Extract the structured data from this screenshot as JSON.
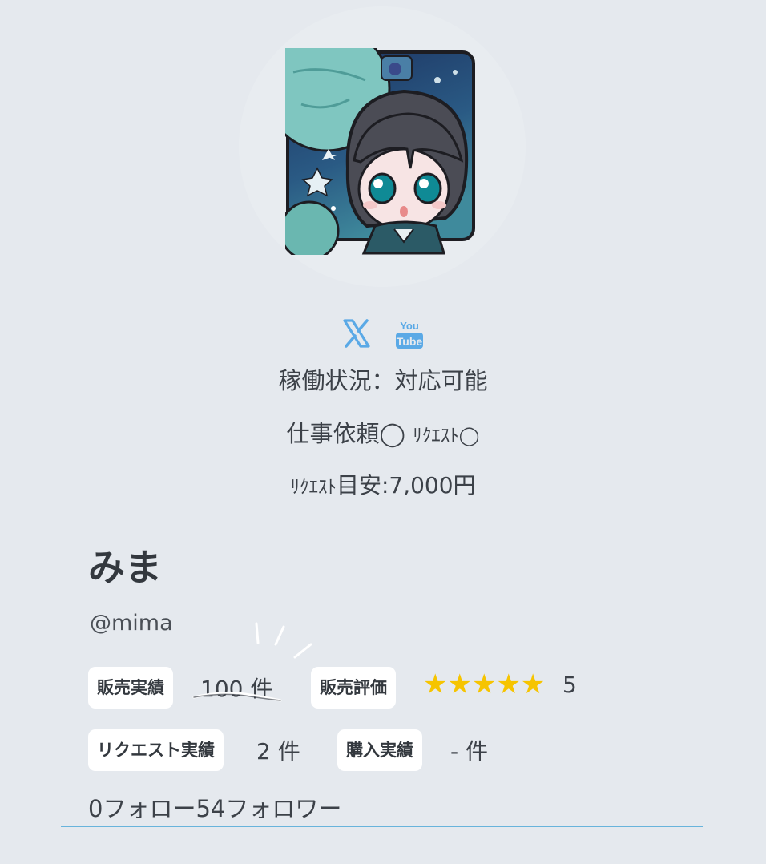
{
  "profile": {
    "avatar_icon": "avatar-illustration-icon",
    "name": "みま",
    "handle": "@mima"
  },
  "social": {
    "x_icon": "x-logo-icon",
    "youtube_icon": "youtube-logo-icon",
    "youtube_text_top": "You",
    "youtube_text_bottom": "Tube",
    "icon_color": "#5aa9e6"
  },
  "status": {
    "availability": "稼働状況：対応可能",
    "work_label": "仕事依頼◯ ",
    "request_label": "ﾘｸｴｽﾄ◯",
    "price_prefix": "ﾘｸｴｽﾄ",
    "price_text": "目安:7,000円"
  },
  "stats": {
    "sales_label": "販売実績",
    "sales_value": "100 件",
    "rating_label": "販売評価",
    "rating_stars": "★★★★★",
    "rating_value": "5",
    "request_label": "リクエスト実績",
    "request_value": "2 件",
    "purchase_label": "購入実績",
    "purchase_value": "- 件",
    "star_color": "#f6c400"
  },
  "follow": {
    "text": "0フォロー54フォロワー"
  }
}
